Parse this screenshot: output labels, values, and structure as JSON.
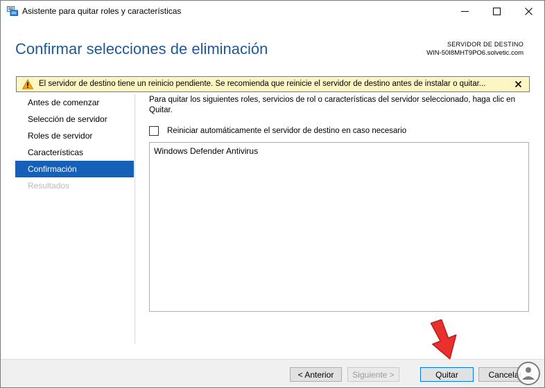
{
  "window": {
    "title": "Asistente para quitar roles y características"
  },
  "header": {
    "page_title": "Confirmar selecciones de eliminación",
    "destination_label": "SERVIDOR DE DESTINO",
    "destination_host": "WIN-50I8MHT9PO6.solvetic.com"
  },
  "warning": {
    "icon": "warning-icon",
    "text": "El servidor de destino tiene un reinicio pendiente. Se recomienda que reinicie el servidor de destino antes de instalar o quitar...",
    "color": "#fdf6c3"
  },
  "nav": {
    "items": [
      {
        "label": "Antes de comenzar",
        "state": "normal"
      },
      {
        "label": "Selección de servidor",
        "state": "normal"
      },
      {
        "label": "Roles de servidor",
        "state": "normal"
      },
      {
        "label": "Características",
        "state": "normal"
      },
      {
        "label": "Confirmación",
        "state": "selected"
      },
      {
        "label": "Resultados",
        "state": "disabled"
      }
    ],
    "selected_color": "#1660b7"
  },
  "content": {
    "intro": "Para quitar los siguientes roles, servicios de rol o características del servidor seleccionado, haga clic en Quitar.",
    "restart_checkbox": {
      "label": "Reiniciar automáticamente el servidor de destino en caso necesario",
      "checked": false
    },
    "list_items": [
      "Windows Defender Antivirus"
    ]
  },
  "footer": {
    "prev_label": "< Anterior",
    "next_label": "Siguiente >",
    "quit_label": "Quitar",
    "cancel_label": "Cancelar"
  },
  "colors": {
    "title": "#1e5a96",
    "annotation_arrow": "#e8302c"
  }
}
